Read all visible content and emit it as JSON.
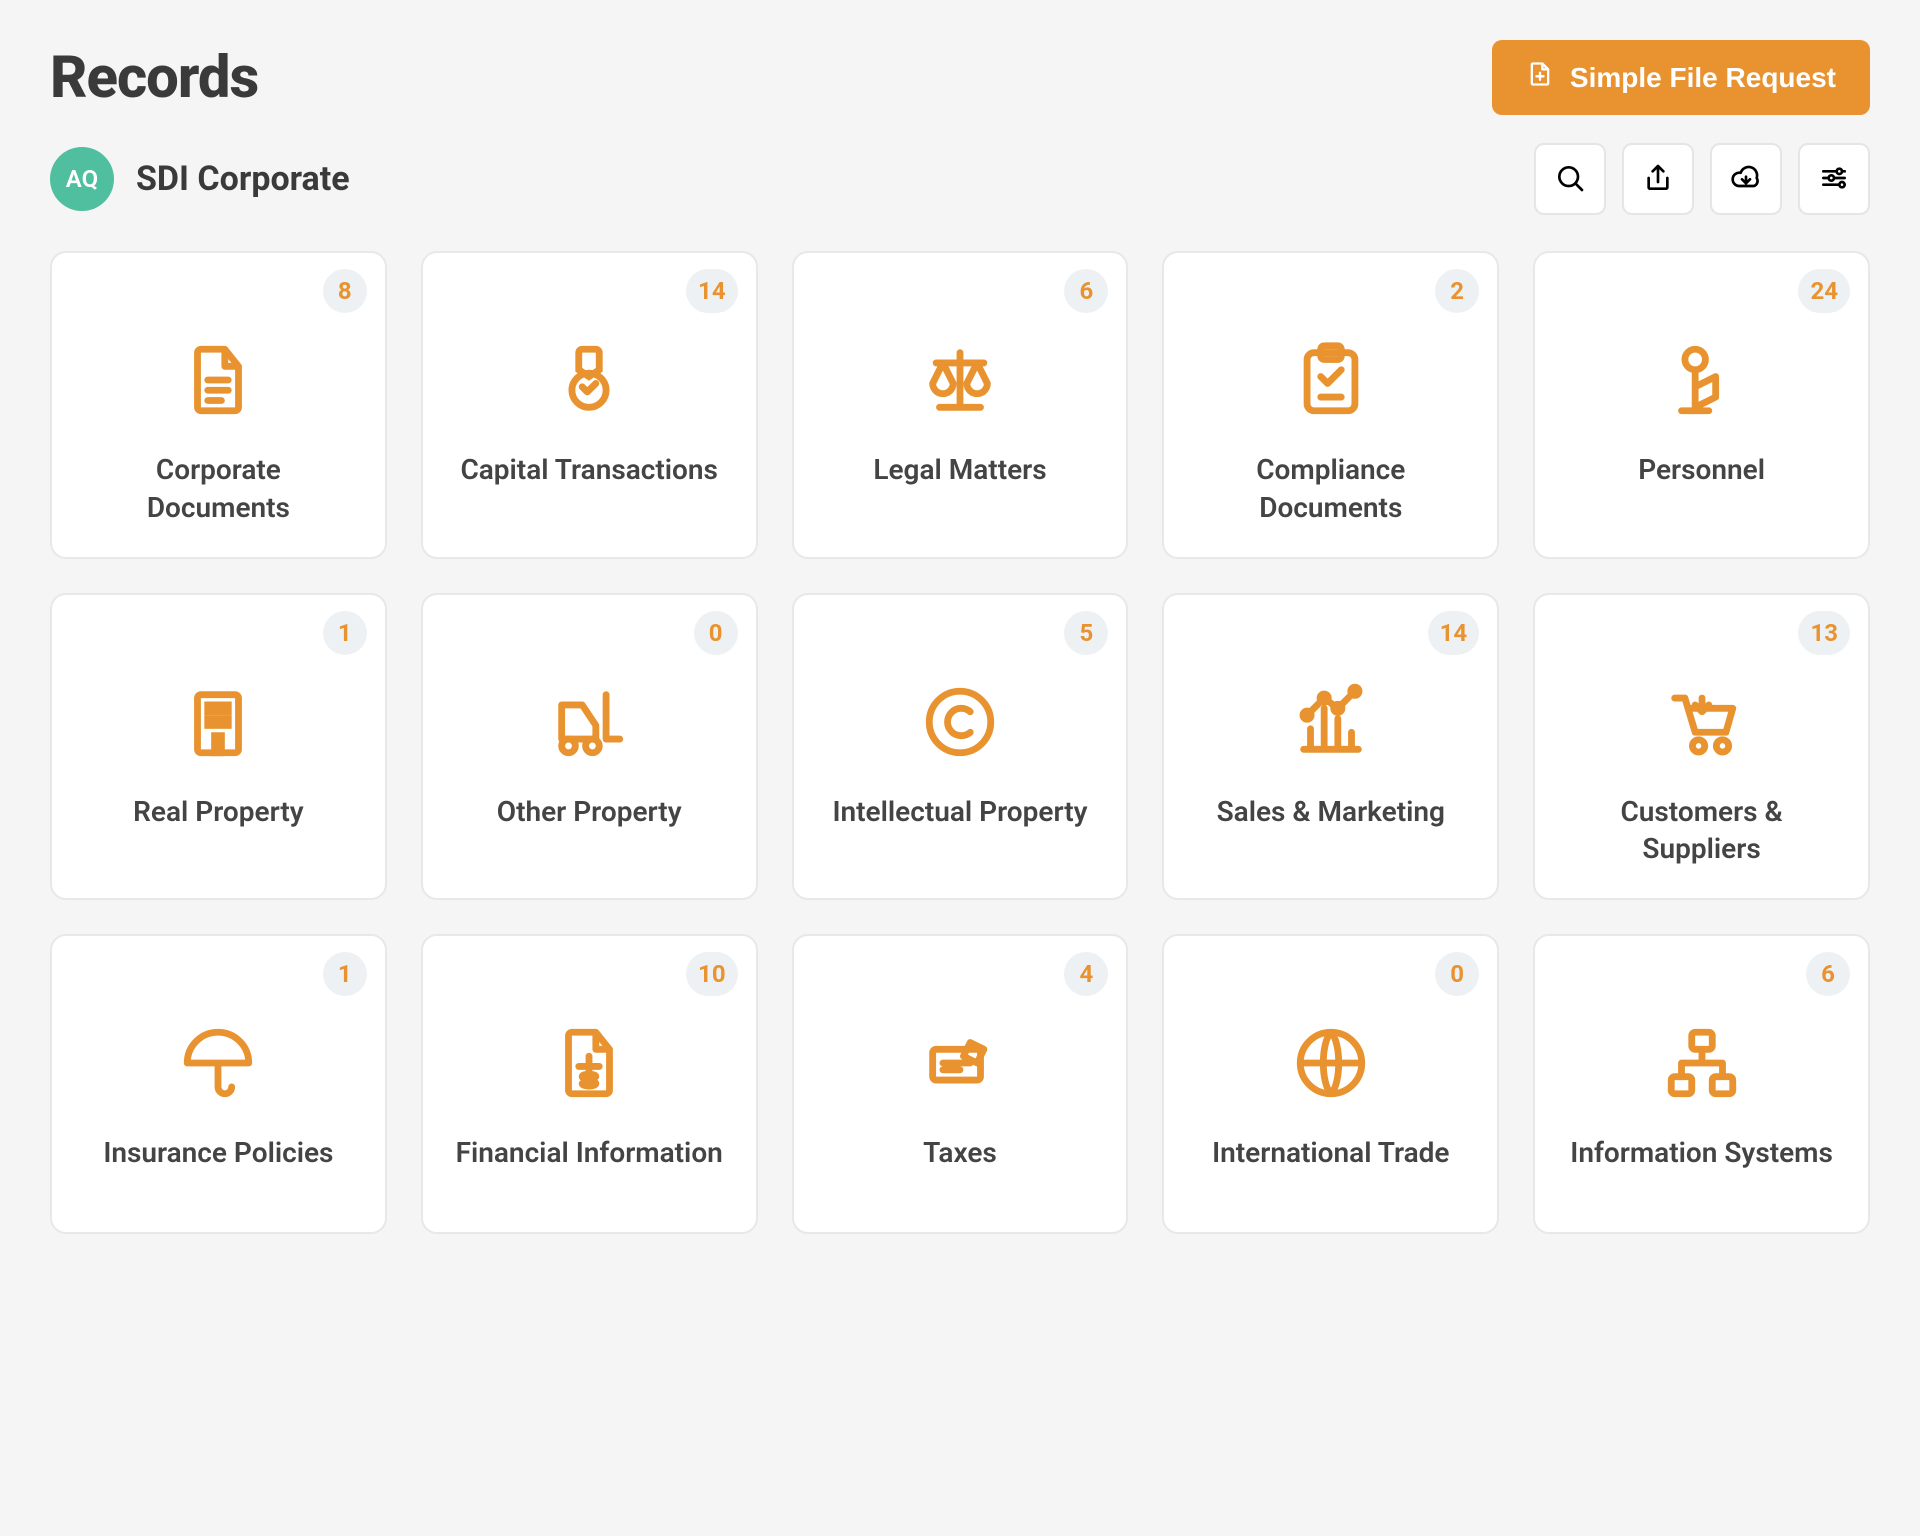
{
  "page": {
    "title": "Records",
    "primary_button_label": "Simple File Request"
  },
  "entity": {
    "initials": "AQ",
    "name": "SDI Corporate"
  },
  "toolbar": {
    "search": "search",
    "share": "share",
    "download": "download",
    "filter": "filter"
  },
  "cards": [
    {
      "label": "Corporate Documents",
      "count": 8,
      "icon": "document"
    },
    {
      "label": "Capital Transactions",
      "count": 14,
      "icon": "award"
    },
    {
      "label": "Legal Matters",
      "count": 6,
      "icon": "scales"
    },
    {
      "label": "Compliance Documents",
      "count": 2,
      "icon": "checklist"
    },
    {
      "label": "Personnel",
      "count": 24,
      "icon": "personnel"
    },
    {
      "label": "Real Property",
      "count": 1,
      "icon": "building"
    },
    {
      "label": "Other Property",
      "count": 0,
      "icon": "forklift"
    },
    {
      "label": "Intellectual Property",
      "count": 5,
      "icon": "copyright"
    },
    {
      "label": "Sales & Marketing",
      "count": 14,
      "icon": "chart"
    },
    {
      "label": "Customers & Suppliers",
      "count": 13,
      "icon": "cart"
    },
    {
      "label": "Insurance Policies",
      "count": 1,
      "icon": "umbrella"
    },
    {
      "label": "Financial Information",
      "count": 10,
      "icon": "invoice"
    },
    {
      "label": "Taxes",
      "count": 4,
      "icon": "check"
    },
    {
      "label": "International Trade",
      "count": 0,
      "icon": "globe"
    },
    {
      "label": "Information Systems",
      "count": 6,
      "icon": "network"
    }
  ]
}
